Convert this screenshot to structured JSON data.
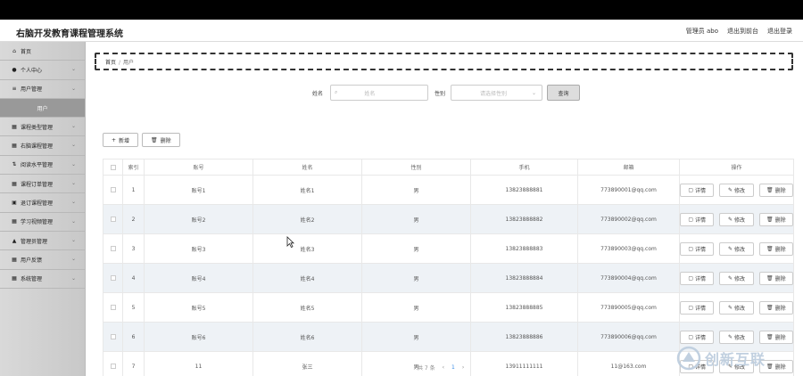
{
  "header": {
    "title": "右脑开发教育课程管理系统",
    "admin_label": "管理员 abo",
    "front_link": "退出到前台",
    "logout": "退出登录"
  },
  "sidebar": {
    "items": [
      {
        "icon": "home-icon",
        "glyph": "⌂",
        "label": "首页",
        "chevron": false
      },
      {
        "icon": "user-icon",
        "glyph": "●",
        "label": "个人中心",
        "chevron": true
      },
      {
        "icon": "list-icon",
        "glyph": "≡",
        "label": "用户管理",
        "chevron": true
      },
      {
        "icon": "",
        "glyph": "",
        "label": "用户",
        "chevron": false,
        "sub": true
      },
      {
        "icon": "grid-icon",
        "glyph": "▦",
        "label": "课程类型管理",
        "chevron": true
      },
      {
        "icon": "grid-icon",
        "glyph": "▦",
        "label": "右脑课程管理",
        "chevron": true
      },
      {
        "icon": "level-icon",
        "glyph": "⇅",
        "label": "阅读水平管理",
        "chevron": true
      },
      {
        "icon": "grid-icon",
        "glyph": "▦",
        "label": "课程订单管理",
        "chevron": true
      },
      {
        "icon": "doc-icon",
        "glyph": "▣",
        "label": "退订课程管理",
        "chevron": true
      },
      {
        "icon": "grid-icon",
        "glyph": "▦",
        "label": "学习视频管理",
        "chevron": true
      },
      {
        "icon": "admin-icon",
        "glyph": "▲",
        "label": "管理员管理",
        "chevron": true
      },
      {
        "icon": "grid-icon",
        "glyph": "▦",
        "label": "用户反馈",
        "chevron": true
      },
      {
        "icon": "grid-icon",
        "glyph": "▦",
        "label": "系统管理",
        "chevron": true
      }
    ]
  },
  "breadcrumb": {
    "home": "首页",
    "separator": "/",
    "current": "用户"
  },
  "search": {
    "name_label": "姓名",
    "name_placeholder": "姓名",
    "gender_label": "性别",
    "gender_placeholder": "请选择性别",
    "query_button": "查询"
  },
  "toolbar": {
    "add": "新增",
    "delete": "删除"
  },
  "table": {
    "headers": [
      "",
      "索引",
      "账号",
      "姓名",
      "性别",
      "手机",
      "邮箱",
      "操作"
    ],
    "rows": [
      {
        "index": "1",
        "account": "账号1",
        "name": "姓名1",
        "gender": "男",
        "phone": "13823888881",
        "email": "773890001@qq.com"
      },
      {
        "index": "2",
        "account": "账号2",
        "name": "姓名2",
        "gender": "男",
        "phone": "13823888882",
        "email": "773890002@qq.com"
      },
      {
        "index": "3",
        "account": "账号3",
        "name": "姓名3",
        "gender": "男",
        "phone": "13823888883",
        "email": "773890003@qq.com"
      },
      {
        "index": "4",
        "account": "账号4",
        "name": "姓名4",
        "gender": "男",
        "phone": "13823888884",
        "email": "773890004@qq.com"
      },
      {
        "index": "5",
        "account": "账号5",
        "name": "姓名5",
        "gender": "男",
        "phone": "13823888885",
        "email": "773890005@qq.com"
      },
      {
        "index": "6",
        "account": "账号6",
        "name": "姓名6",
        "gender": "男",
        "phone": "13823888886",
        "email": "773890006@qq.com"
      },
      {
        "index": "7",
        "account": "11",
        "name": "张三",
        "gender": "男",
        "phone": "13911111111",
        "email": "11@163.com"
      }
    ],
    "actions": {
      "detail": "详情",
      "edit": "修改",
      "delete": "删除"
    }
  },
  "pagination": {
    "total": "共 7 条",
    "prev": "‹",
    "page": "1",
    "next": "›"
  },
  "watermark": {
    "text": "创新互联"
  },
  "colors": {
    "sidebar_bg": "#cccccc",
    "row_alt": "#eef2f6",
    "page_link": "#3a8ee6"
  }
}
